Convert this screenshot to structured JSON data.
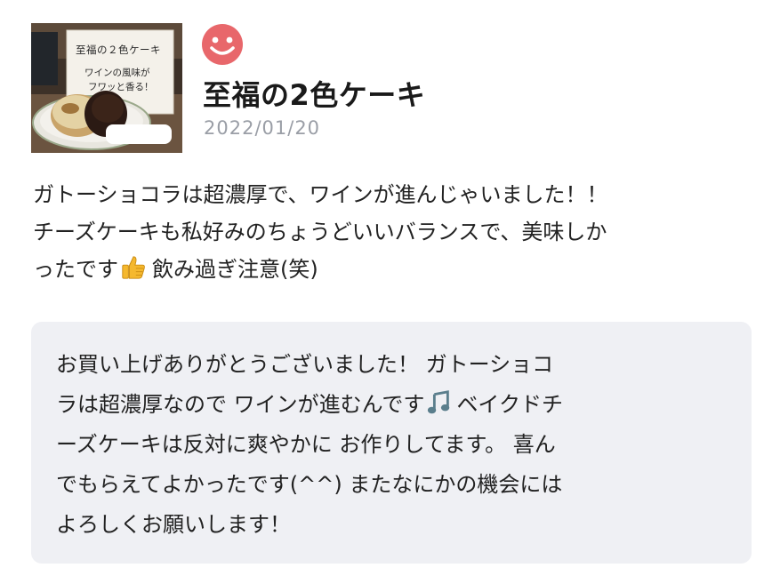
{
  "review": {
    "thumbnail": {
      "line1": "至福の２色ケーキ",
      "line2": "ワインの風味が",
      "line3": "フワッと香る！"
    },
    "reviewer_icon": "smiley-face-icon",
    "product_title": "至福の2色ケーキ",
    "date": "2022/01/20",
    "body_lines": [
      "ガトーショコラは超濃厚で、ワインが進んじゃいました！！",
      "チーズケーキも私好みのちょうどいいバランスで、美味しか",
      "ったです",
      "飲み過ぎ注意(笑)"
    ],
    "body_emoji": "thumbs-up-icon"
  },
  "reply": {
    "lines": [
      "お買い上げありがとうございました！ ガトーショコ",
      "ラは超濃厚なので ワインが進むんです",
      "ベイクドチ",
      "ーズケーキは反対に爽やかに お作りしてます。 喜ん",
      "でもらえてよかったです(^^) またなにかの機会には",
      "よろしくお願いします！"
    ],
    "reply_emoji": "music-note-icon"
  },
  "colors": {
    "smiley": "#e8676b",
    "date": "#9a9ea6",
    "reply_background": "#eff0f4",
    "thumbs_up": "#f5b82e",
    "music_note": "#5a7e8c"
  }
}
